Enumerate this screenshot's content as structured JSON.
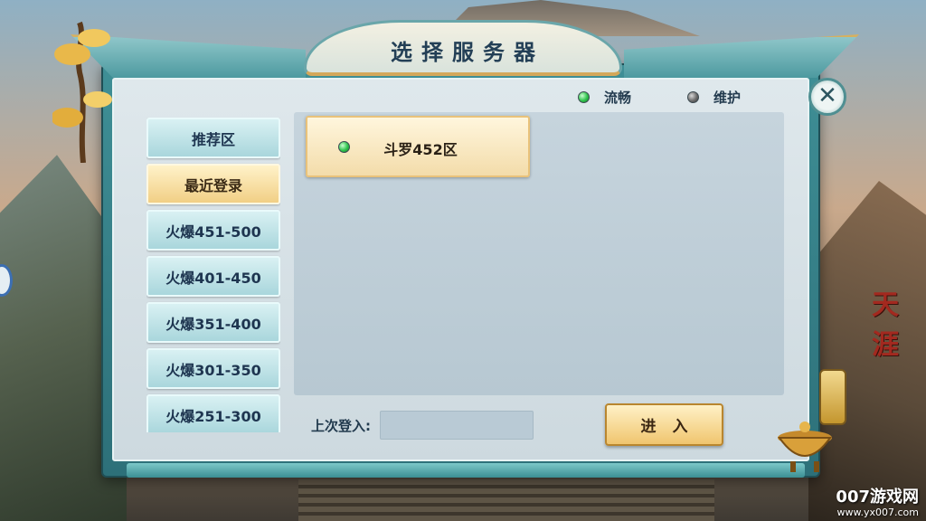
{
  "title": "选择服务器",
  "legend": {
    "smooth_label": "流畅",
    "maintenance_label": "维护"
  },
  "close_label": "✕",
  "categories": [
    {
      "label": "推荐区",
      "active": false
    },
    {
      "label": "最近登录",
      "active": true
    },
    {
      "label": "火爆451-500",
      "active": false
    },
    {
      "label": "火爆401-450",
      "active": false
    },
    {
      "label": "火爆351-400",
      "active": false
    },
    {
      "label": "火爆301-350",
      "active": false
    },
    {
      "label": "火爆251-300",
      "active": false
    }
  ],
  "servers": [
    {
      "name": "斗罗452区",
      "status": "smooth"
    }
  ],
  "last_login": {
    "label": "上次登入:",
    "value": ""
  },
  "enter_button": "进 入",
  "watermark": {
    "line1": "007游戏网",
    "line2": "www.yx007.com"
  },
  "side_text": "天涯",
  "colors": {
    "status_smooth": "#2fc34c",
    "status_maintenance": "#6d6d6d",
    "active_tab": "#f1cf85",
    "tab": "#a9d6dc"
  }
}
